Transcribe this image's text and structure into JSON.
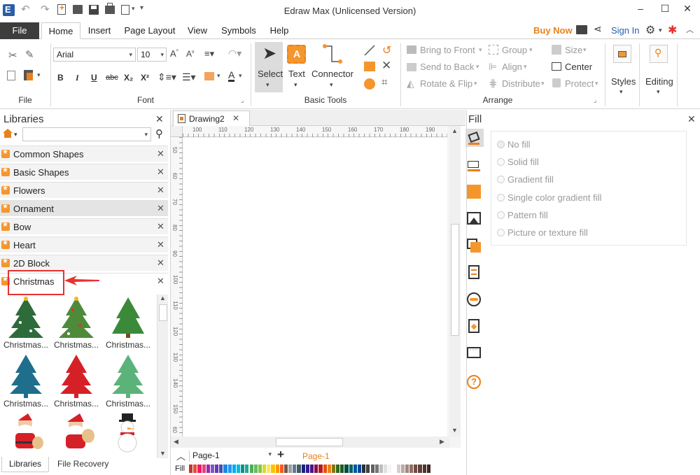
{
  "app": {
    "title": "Edraw Max (Unlicensed Version)"
  },
  "window": {
    "minimize": "–",
    "maximize": "☐",
    "close": "✕"
  },
  "menu": {
    "tabs": [
      "File",
      "Home",
      "Insert",
      "Page Layout",
      "View",
      "Symbols",
      "Help"
    ],
    "buy_now": "Buy Now",
    "sign_in": "Sign In"
  },
  "ribbon": {
    "font_name": "Arial",
    "font_size": "10",
    "groups": {
      "file": "File",
      "font": "Font",
      "basic_tools": "Basic Tools",
      "arrange": "Arrange"
    },
    "basic_tools": {
      "select": "Select",
      "text": "Text",
      "connector": "Connector"
    },
    "arrange": {
      "bring_to_front": "Bring to Front",
      "send_to_back": "Send to Back",
      "rotate_flip": "Rotate & Flip",
      "group": "Group",
      "align": "Align",
      "distribute": "Distribute",
      "size": "Size",
      "center": "Center",
      "protect": "Protect"
    },
    "styles": "Styles",
    "editing": "Editing",
    "font_buttons": [
      "B",
      "I",
      "U",
      "abc",
      "X₂",
      "X²"
    ]
  },
  "libraries": {
    "title": "Libraries",
    "search_value": "",
    "items": [
      "Common Shapes",
      "Basic Shapes",
      "Flowers",
      "Ornament",
      "Bow",
      "Heart",
      "2D Block",
      "Christmas"
    ],
    "shapes": [
      "Christmas...",
      "Christmas...",
      "Christmas...",
      "Christmas...",
      "Christmas...",
      "Christmas..."
    ],
    "bottom_tabs": [
      "Libraries",
      "File Recovery"
    ]
  },
  "document": {
    "tab": "Drawing2",
    "ruler_h": [
      "100",
      "110",
      "120",
      "130",
      "140",
      "150",
      "160",
      "170",
      "180",
      "190"
    ],
    "ruler_v": [
      "50",
      "60",
      "70",
      "80",
      "90",
      "100",
      "110",
      "120",
      "130",
      "140",
      "150",
      "60"
    ],
    "page_select": "Page-1",
    "page_tab": "Page-1",
    "fill_label": "Fill"
  },
  "fill": {
    "title": "Fill",
    "options": [
      "No fill",
      "Solid fill",
      "Gradient fill",
      "Single color gradient fill",
      "Pattern fill",
      "Picture or texture fill"
    ]
  },
  "colors": {
    "accent": "#e8811b",
    "brand_blue": "#2b5ea7",
    "annotation_red": "#e8312f",
    "file_tab": "#3d3d3d"
  },
  "palette": [
    "#c0392b",
    "#e74c3c",
    "#e91e63",
    "#ec407a",
    "#9c27b0",
    "#7e57c2",
    "#673ab7",
    "#3f51b5",
    "#1e88e5",
    "#2196f3",
    "#03a9f4",
    "#00bcd4",
    "#009688",
    "#26a69a",
    "#4caf50",
    "#66bb6a",
    "#8bc34a",
    "#cddc39",
    "#ffeb3b",
    "#ffc107",
    "#ff9800",
    "#ff5722",
    "#795548",
    "#9e9e9e",
    "#607d8b",
    "#455a64",
    "#1a237e",
    "#311b92",
    "#4a148c",
    "#880e4f",
    "#b71c1c",
    "#e65100",
    "#f57f17",
    "#827717",
    "#33691e",
    "#1b5e20",
    "#004d40",
    "#006064",
    "#01579b",
    "#0d47a1",
    "#263238",
    "#424242",
    "#616161",
    "#757575",
    "#bdbdbd",
    "#e0e0e0",
    "#f5f5f5",
    "#ffffff",
    "#d7ccc8",
    "#bcaaa4",
    "#a1887f",
    "#8d6e63",
    "#6d4c41",
    "#5d4037",
    "#4e342e",
    "#3e2723"
  ]
}
